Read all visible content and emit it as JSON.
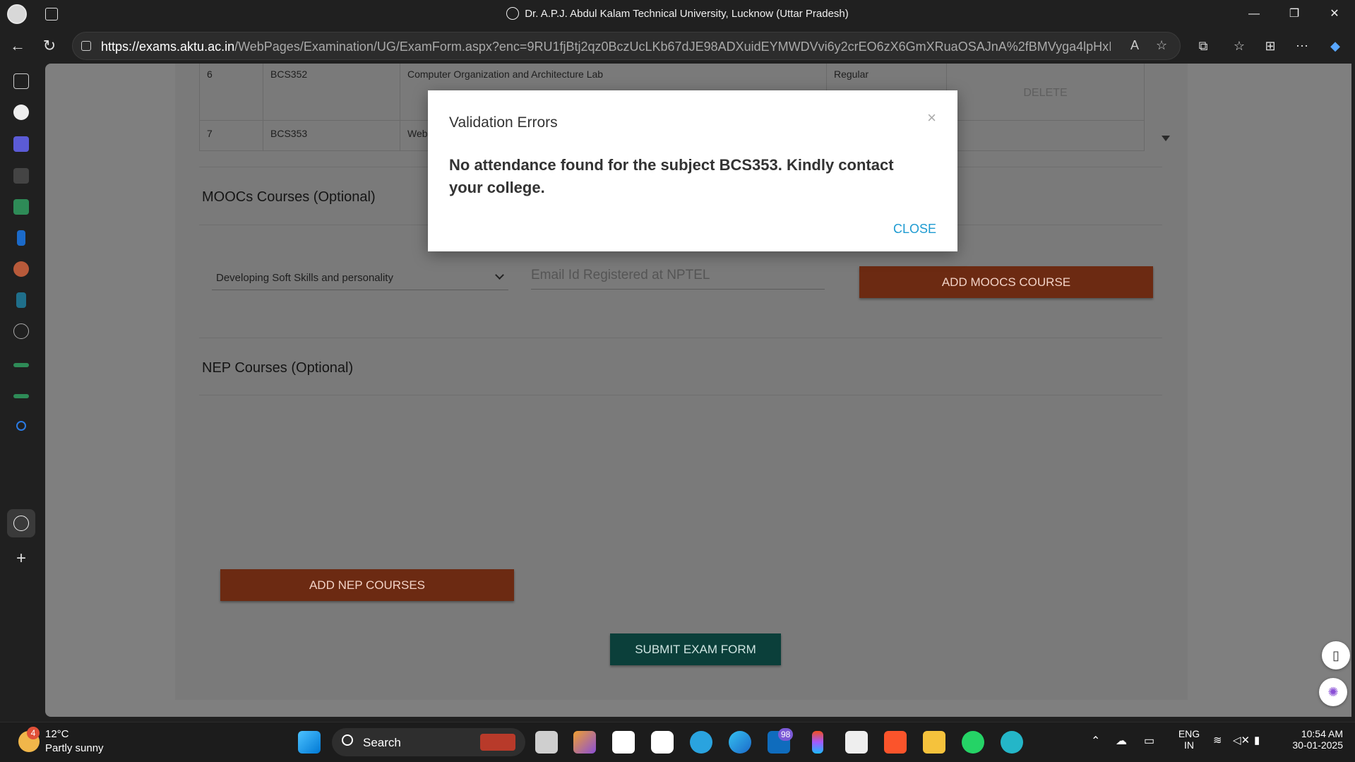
{
  "window": {
    "title": "Dr. A.P.J. Abdul Kalam Technical University, Lucknow (Uttar Pradesh)",
    "controls": {
      "minimize": "—",
      "restore": "❐",
      "close": "✕"
    }
  },
  "browser": {
    "url_host": "https://exams.aktu.ac.in",
    "url_path": "/WebPages/Examination/UG/ExamForm.aspx?enc=9RU1fjBtj2qz0BczUcLKb67dJE98ADXuidEYMWDVvi6y2crEO6zX6GmXRuaOSAJnA%2fBMVyga4lpHxIh8Y6Lksw%..."
  },
  "subjects_table": {
    "rows": [
      {
        "index": "6",
        "code": "BCS352",
        "name": "Computer Organization and Architecture Lab",
        "type": "Regular",
        "action": "DELETE"
      },
      {
        "index": "7",
        "code": "BCS353",
        "name": "Web",
        "type": "",
        "action": ""
      }
    ]
  },
  "moocs": {
    "title": "MOOCs Courses (Optional)",
    "selected_course": "Developing Soft Skills and personality",
    "email_placeholder": "Email Id Registered at NPTEL",
    "add_button": "ADD MOOCS COURSE"
  },
  "nep": {
    "title": "NEP Courses (Optional)",
    "add_button": "ADD NEP COURSES"
  },
  "submit_button": "SUBMIT EXAM FORM",
  "modal": {
    "title": "Validation Errors",
    "close_x": "×",
    "message": "No attendance found for the subject BCS353. Kindly contact your college.",
    "close_button": "CLOSE"
  },
  "taskbar": {
    "weather_temp": "12°C",
    "weather_desc": "Partly sunny",
    "weather_badge": "4",
    "search_label": "Search",
    "mail_badge": "98",
    "lang_line1": "ENG",
    "lang_line2": "IN",
    "time": "10:54 AM",
    "date": "30-01-2025"
  },
  "colors": {
    "orange_button": "#e04e1b",
    "teal_button": "#00897b",
    "link_blue": "#1e9bd1"
  }
}
